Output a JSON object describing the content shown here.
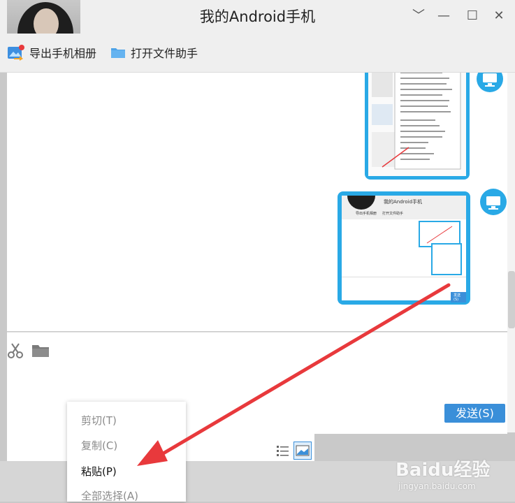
{
  "window": {
    "title": "我的Android手机",
    "controls": {
      "minimize": "﹀",
      "restore": "—",
      "maximize": "☐",
      "close": "✕"
    }
  },
  "toolbar": {
    "export_album": "导出手机相册",
    "open_file_helper": "打开文件助手"
  },
  "compose": {
    "send_label": "发送(S)"
  },
  "context_menu": {
    "cut": "剪切(T)",
    "copy": "复制(C)",
    "paste": "粘贴(P)",
    "select_all": "全部选择(A)"
  },
  "nested_screenshot": {
    "title": "我的Android手机",
    "export_album": "导出手机相册",
    "open_file_helper": "打开文件助手",
    "send_label": "发送(S)"
  },
  "watermark": {
    "brand": "Baidu经验",
    "url": "jingyan.baidu.com"
  },
  "colors": {
    "accent": "#29a9e6",
    "send_button": "#3a8fd9",
    "arrow": "#e8393c"
  },
  "icons": {
    "export_album": "image-export-icon",
    "open_file_helper": "folder-icon",
    "cut": "scissors-icon",
    "folder": "folder-icon",
    "avatar": "desktop-monitor-icon"
  }
}
